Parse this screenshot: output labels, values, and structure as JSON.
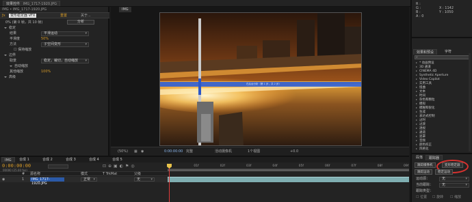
{
  "top": {
    "project_tab": "项目",
    "effects_tab": "效果控件",
    "effects_tab_file": "IMG_1717-1920.JPG",
    "breadcrumb": "IMG • IMG_1717-1920.JPG"
  },
  "effects": {
    "fx_name": "变形稳定器 VFX",
    "reset_label": "重置",
    "about_label": "关于...",
    "analyze_label": "分析",
    "rows": [
      {
        "label": "0% (第 0 帧，共 10 帧)",
        "value": "",
        "indent": 8,
        "kind": "status"
      },
      {
        "label": "稳定",
        "value": "",
        "indent": 6,
        "kind": "section"
      },
      {
        "label": "结果",
        "value": "平滑运动",
        "indent": 14,
        "kind": "dropdown"
      },
      {
        "label": "平滑度",
        "value": "50%",
        "indent": 14,
        "kind": "value"
      },
      {
        "label": "方法",
        "value": "子空间变形",
        "indent": 14,
        "kind": "dropdown"
      },
      {
        "label": "保持缩放",
        "value": "",
        "indent": 20,
        "kind": "check"
      },
      {
        "label": "边界",
        "value": "",
        "indent": 6,
        "kind": "section"
      },
      {
        "label": "取景",
        "value": "稳定，裁切，自动缩放",
        "indent": 14,
        "kind": "dropdown"
      },
      {
        "label": "自动缩放",
        "value": "",
        "indent": 14,
        "kind": "section"
      },
      {
        "label": "其他缩放",
        "value": "100%",
        "indent": 14,
        "kind": "value"
      },
      {
        "label": "高级",
        "value": "",
        "indent": 6,
        "kind": "section"
      }
    ]
  },
  "viewer": {
    "comp_tab": "IMG",
    "zoom": "(50%)",
    "timecode": "0:00:00:00",
    "resolution": "完整",
    "camera": "活动摄像机",
    "views": "1个视图",
    "offset": "+0.0",
    "analysis_overlay": "在后台分析（第 1 步，共 2 步）"
  },
  "info": {
    "r": "R :",
    "g": "G :",
    "b": "B :",
    "a": "A : 0",
    "x": "X : 1142",
    "y": "Y : 1050"
  },
  "fx_presets": {
    "tab1": "效果和预设",
    "tab2": "字符",
    "search_value": "",
    "items": [
      "* 动画预设",
      "3D 通道",
      "CINEMA 4D",
      "Synthetic Aperture",
      "Video Copilot",
      "实用工具",
      "扭曲",
      "文本",
      "时间",
      "杂色和颗粒",
      "模拟",
      "模糊和锐化",
      "生成",
      "表达式控制",
      "过时",
      "过渡",
      "透视",
      "通道",
      "遮罩",
      "音频",
      "颜色校正",
      "风格化"
    ]
  },
  "timeline": {
    "tabs": [
      "IMG",
      "合成 1",
      "合成 2",
      "合成 3",
      "合成 4",
      "合成 5"
    ],
    "timecode": "0:00:00:00",
    "fps_note": "00000 (25.00 fps)",
    "ticks": [
      "0f",
      "01f",
      "02f",
      "03f",
      "04f",
      "05f",
      "06f",
      "07f",
      "08f",
      "09f"
    ],
    "col_num": "#",
    "col_source": "源名称",
    "col_mode": "模式",
    "col_trkmat": "T  TrkMat",
    "col_parent": "父级",
    "layer_index": "1",
    "layer_name": "IMG_1717-1920.JPG",
    "layer_mode": "正常",
    "layer_parent": "无"
  },
  "tracker": {
    "tab1": "段落",
    "tab2": "跟踪器",
    "btn_track_camera": "跟踪摄像机",
    "btn_warp": "变形稳定器",
    "btn_track_motion": "跟踪运动",
    "btn_stabilize": "稳定运动",
    "motion_source_label": "运动源：",
    "motion_source_value": "无",
    "current_track_label": "当前跟踪：",
    "current_track_value": "无",
    "track_type_label": "跟踪类型：",
    "position": "位置",
    "rotation": "旋转",
    "scale": "缩放"
  }
}
